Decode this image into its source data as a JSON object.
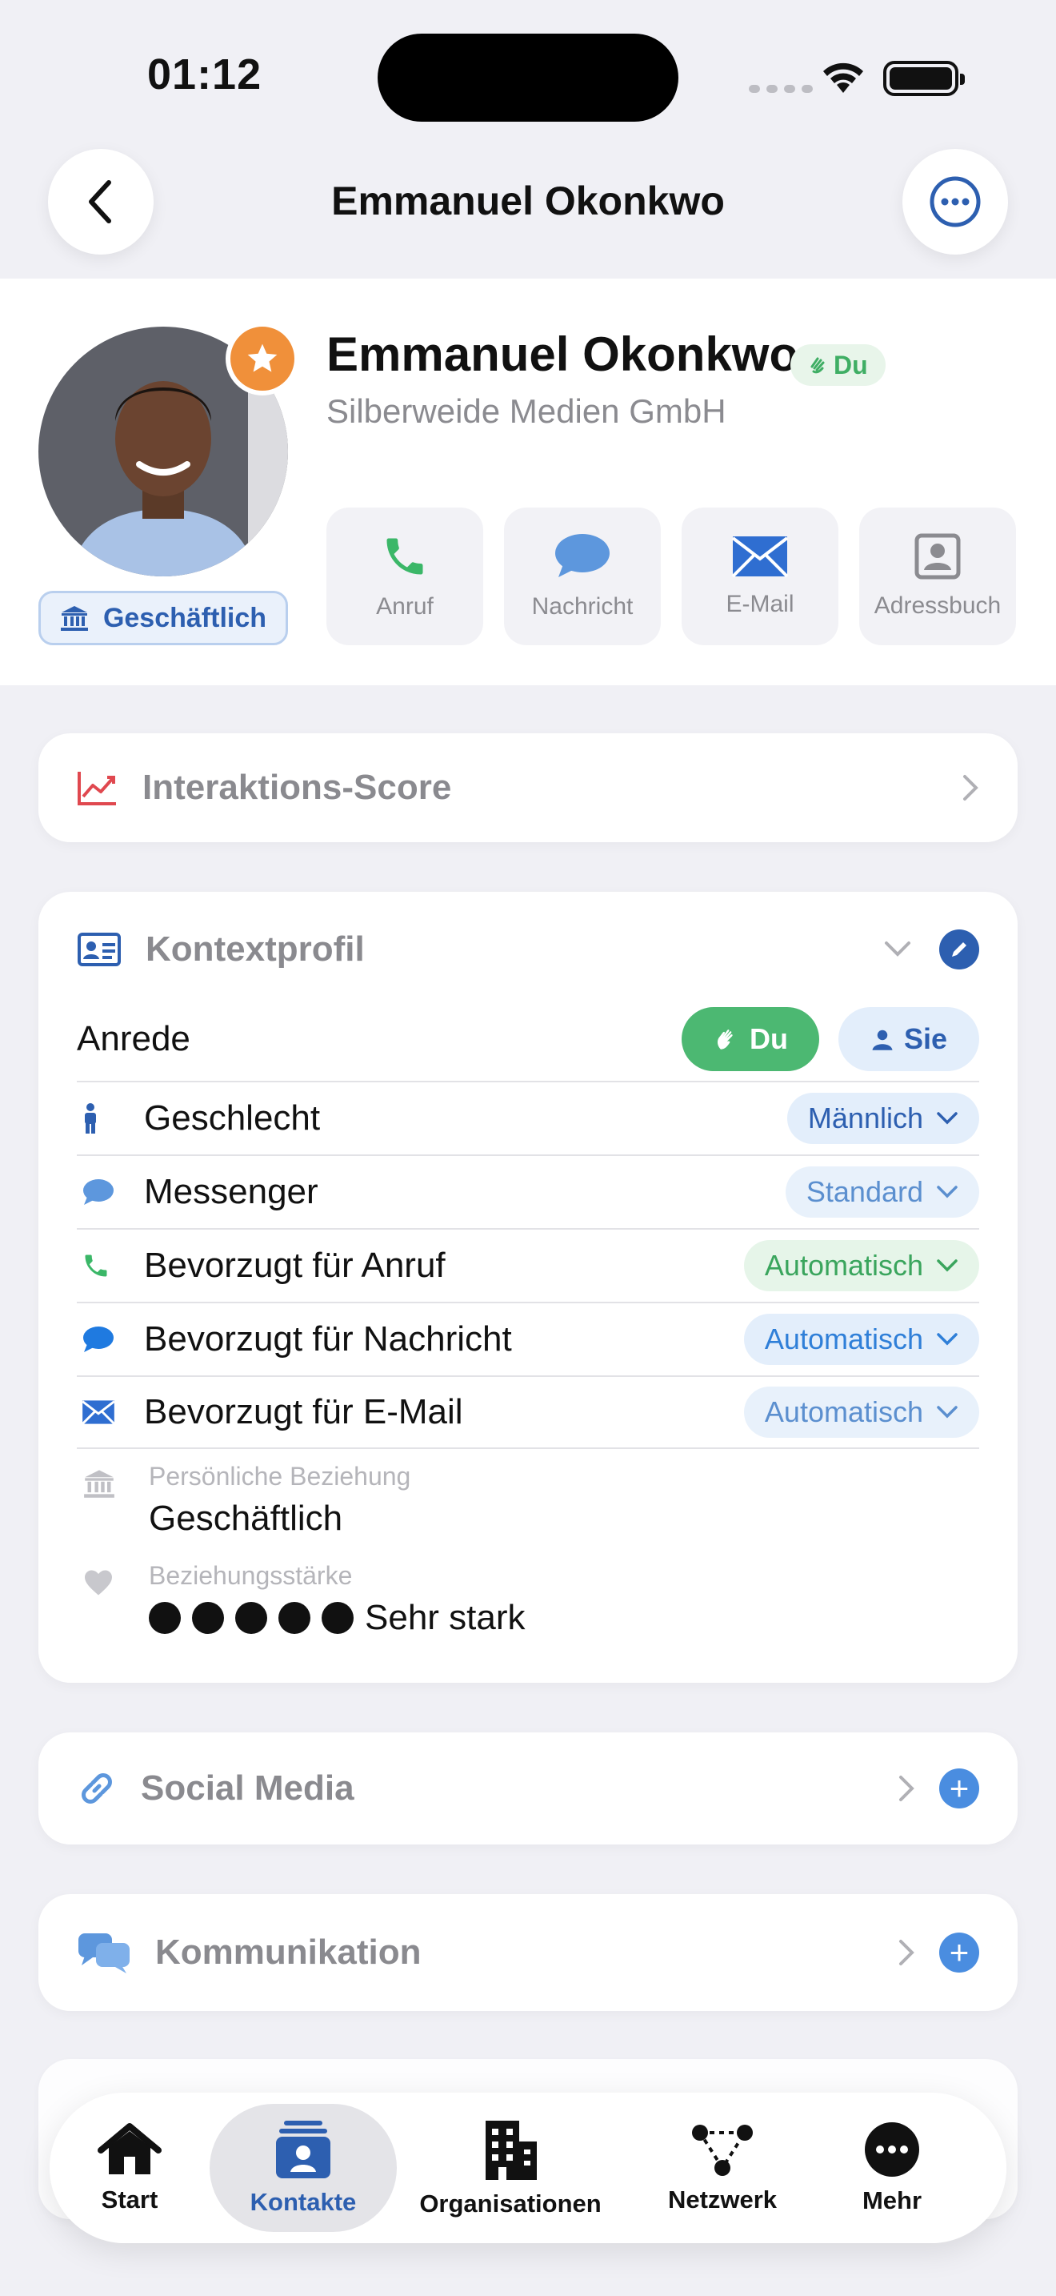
{
  "status": {
    "time": "01:12"
  },
  "nav": {
    "title": "Emmanuel Okonkwo"
  },
  "profile": {
    "name": "Emmanuel Okonkwo",
    "address_badge": "Du",
    "company": "Silberweide Medien GmbH",
    "relationship_chip": "Geschäftlich",
    "actions": [
      {
        "label": "Anruf",
        "icon": "phone-icon"
      },
      {
        "label": "Nachricht",
        "icon": "message-bubble-icon"
      },
      {
        "label": "E-Mail",
        "icon": "envelope-icon"
      },
      {
        "label": "Adressbuch",
        "icon": "contact-card-icon"
      }
    ]
  },
  "score_card": {
    "title": "Interaktions-Score"
  },
  "context": {
    "title": "Kontextprofil",
    "anrede_label": "Anrede",
    "anrede_options": [
      "Du",
      "Sie"
    ],
    "anrede_selected": "Du",
    "rows": [
      {
        "label": "Geschlecht",
        "value": "Männlich"
      },
      {
        "label": "Messenger",
        "value": "Standard"
      },
      {
        "label": "Bevorzugt für Anruf",
        "value": "Automatisch"
      },
      {
        "label": "Bevorzugt für Nachricht",
        "value": "Automatisch"
      },
      {
        "label": "Bevorzugt für E-Mail",
        "value": "Automatisch"
      }
    ],
    "relationship_label": "Persönliche Beziehung",
    "relationship_value": "Geschäftlich",
    "strength_label": "Beziehungsstärke",
    "strength_value": "Sehr stark",
    "strength_level": 5,
    "strength_max": 5
  },
  "social": {
    "title": "Social Media"
  },
  "communication": {
    "title": "Kommunikation"
  },
  "tabs": [
    {
      "label": "Start",
      "icon": "house-icon"
    },
    {
      "label": "Kontakte",
      "icon": "contacts-icon",
      "active": true
    },
    {
      "label": "Organisationen",
      "icon": "building-icon"
    },
    {
      "label": "Netzwerk",
      "icon": "network-icon"
    },
    {
      "label": "Mehr",
      "icon": "more-icon"
    }
  ],
  "colors": {
    "accent": "#2d5fb0",
    "favorite": "#f0903a",
    "du_green": "#4cb872",
    "background": "#f0f0f5"
  }
}
